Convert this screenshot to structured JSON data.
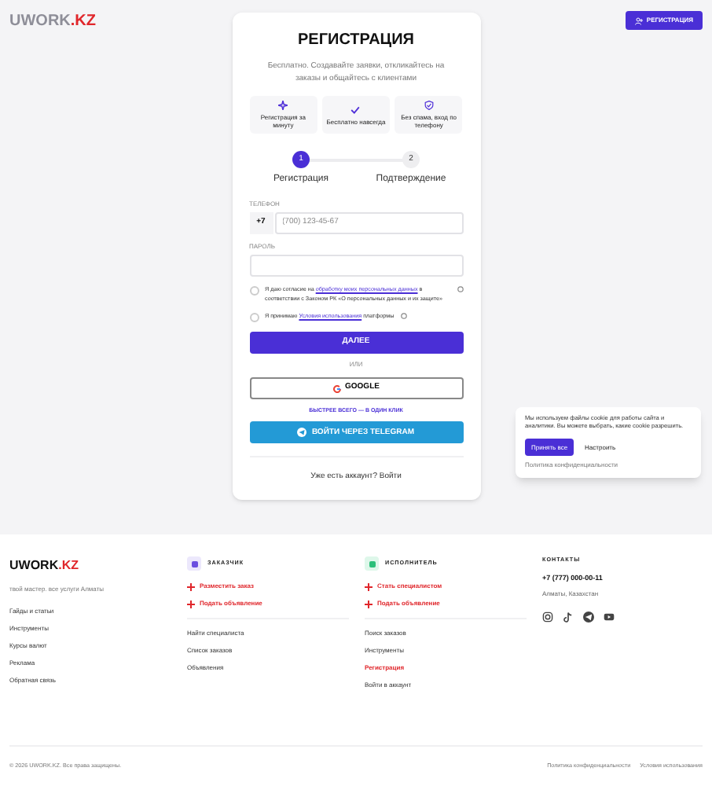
{
  "header": {
    "logo_main": "UWORK",
    "logo_accent": ".KZ",
    "cta": "РЕГИСТРАЦИЯ"
  },
  "card": {
    "title": "РЕГИСТРАЦИЯ",
    "subtitle": "Бесплатно. Создавайте заявки, откликайтесь на заказы и общайтесь с клиентами",
    "features": [
      {
        "kind": "sparkle",
        "label": "Регистрация за минуту"
      },
      {
        "kind": "check",
        "label": "Бесплатно навсегда"
      },
      {
        "kind": "shield",
        "label": "Без спама, вход по телефону"
      }
    ],
    "steps": [
      {
        "number": "1",
        "label": "Регистрация",
        "selected": true
      },
      {
        "number": "2",
        "label": "Подтверждение",
        "selected": false
      }
    ],
    "phone": {
      "label": "ТЕЛЕФОН",
      "prefix": "+7",
      "placeholder": "(700) 123-45-67"
    },
    "password": {
      "label": "ПАРОЛЬ"
    },
    "consents": [
      {
        "before": "Я даю согласие на ",
        "link": "обработку моих персональных данных",
        "after": " в соответствии с Законом РК «О персональных данных и их защите»",
        "checked": false
      },
      {
        "before": "Я принимаю ",
        "link": "Условия использования",
        "after": " платформы",
        "checked": false
      }
    ],
    "submit": "ДАЛЕЕ",
    "or": "ИЛИ",
    "google": "GOOGLE",
    "fast": "БЫСТРЕЕ ВСЕГО — В ОДИН КЛИК",
    "telegram": "ВОЙТИ ЧЕРЕЗ TELEGRAM",
    "login": "Уже есть аккаунт? Войти"
  },
  "cookie": {
    "text": "Мы используем файлы cookie для работы сайта и аналитики. Вы можете выбрать, какие cookie разрешить.",
    "accept": "Принять все",
    "configure": "Настроить",
    "policy": "Политика конфиденциальности"
  },
  "footer": {
    "logo_main": "UWORK",
    "logo_accent": ".KZ",
    "tagline": "твой мастер. все услуги Алматы",
    "links": [
      "Гайды и статьи",
      "Инструменты",
      "Курсы валют",
      "Реклама",
      "Обратная связь"
    ],
    "columns": [
      {
        "kind": "client",
        "title": "ЗАКАЗЧИК",
        "actions": [
          "Разместить заказ",
          "Подать объявление"
        ],
        "links": [
          {
            "label": "Найти специалиста",
            "selected": false
          },
          {
            "label": "Список заказов",
            "selected": false
          },
          {
            "label": "Объявления",
            "selected": false
          }
        ]
      },
      {
        "kind": "worker",
        "title": "ИСПОЛНИТЕЛЬ",
        "actions": [
          "Стать специалистом",
          "Подать объявление"
        ],
        "links": [
          {
            "label": "Поиск заказов",
            "selected": false
          },
          {
            "label": "Инструменты",
            "selected": false
          },
          {
            "label": "Регистрация",
            "selected": true
          },
          {
            "label": "Войти в аккаунт",
            "selected": false
          }
        ]
      }
    ],
    "contacts": {
      "title": "КОНТАКТЫ",
      "phone": "+7 (777) 000-00-11",
      "city": "Алматы, Казахстан"
    },
    "copyright": "© 2026 UWORK.KZ. Все права защищены.",
    "bottom_links": [
      "Политика конфиденциальности",
      "Условия использования"
    ]
  }
}
